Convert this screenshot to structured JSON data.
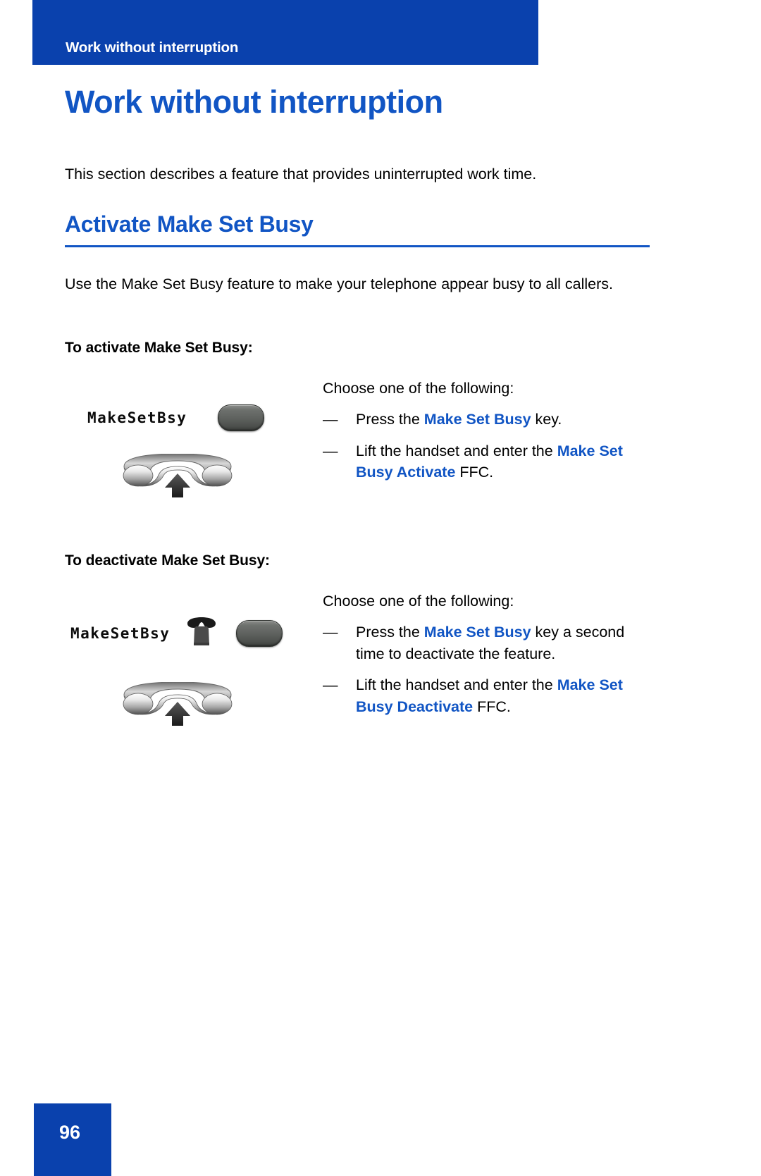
{
  "running_header": {
    "title": "Work without interruption"
  },
  "page": {
    "chapter_title": "Work without interruption",
    "intro": "This section describes a feature that provides uninterrupted work time.",
    "page_number": "96"
  },
  "section": {
    "title": "Activate Make Set Busy",
    "body": "Use the Make Set Busy feature to make your telephone appear busy to all callers."
  },
  "procedures": [
    {
      "heading": "To activate Make Set Busy:",
      "choose_line": "Choose one of the following:",
      "lcd_label": "MakeSetBsy",
      "icons": [
        "feature-key-icon",
        "handset-lift-icon"
      ],
      "steps": [
        {
          "dash": "—",
          "parts": [
            {
              "text": "Press the ",
              "emphasis": false
            },
            {
              "text": "Make Set Busy",
              "emphasis": true
            },
            {
              "text": " key.",
              "emphasis": false
            }
          ]
        },
        {
          "dash": "—",
          "parts": [
            {
              "text": "Lift the handset and enter the ",
              "emphasis": false
            },
            {
              "text": "Make Set Busy Activate",
              "emphasis": true
            },
            {
              "text": " FFC.",
              "emphasis": false
            }
          ]
        }
      ]
    },
    {
      "heading": "To deactivate Make Set Busy:",
      "choose_line": "Choose one of the following:",
      "lcd_label": "MakeSetBsy",
      "icons": [
        "telephone-icon",
        "feature-key-icon",
        "handset-lift-icon"
      ],
      "steps": [
        {
          "dash": "—",
          "parts": [
            {
              "text": "Press the ",
              "emphasis": false
            },
            {
              "text": "Make Set Busy",
              "emphasis": true
            },
            {
              "text": " key a second time to deactivate the feature.",
              "emphasis": false
            }
          ]
        },
        {
          "dash": "—",
          "parts": [
            {
              "text": "Lift the handset and enter the ",
              "emphasis": false
            },
            {
              "text": "Make Set Busy Deactivate",
              "emphasis": true
            },
            {
              "text": " FFC.",
              "emphasis": false
            }
          ]
        }
      ]
    }
  ],
  "colors": {
    "brand_blue": "#0A41AD",
    "heading_blue": "#1155C4",
    "text_black": "#000000",
    "key_gray": "#5d605d"
  }
}
